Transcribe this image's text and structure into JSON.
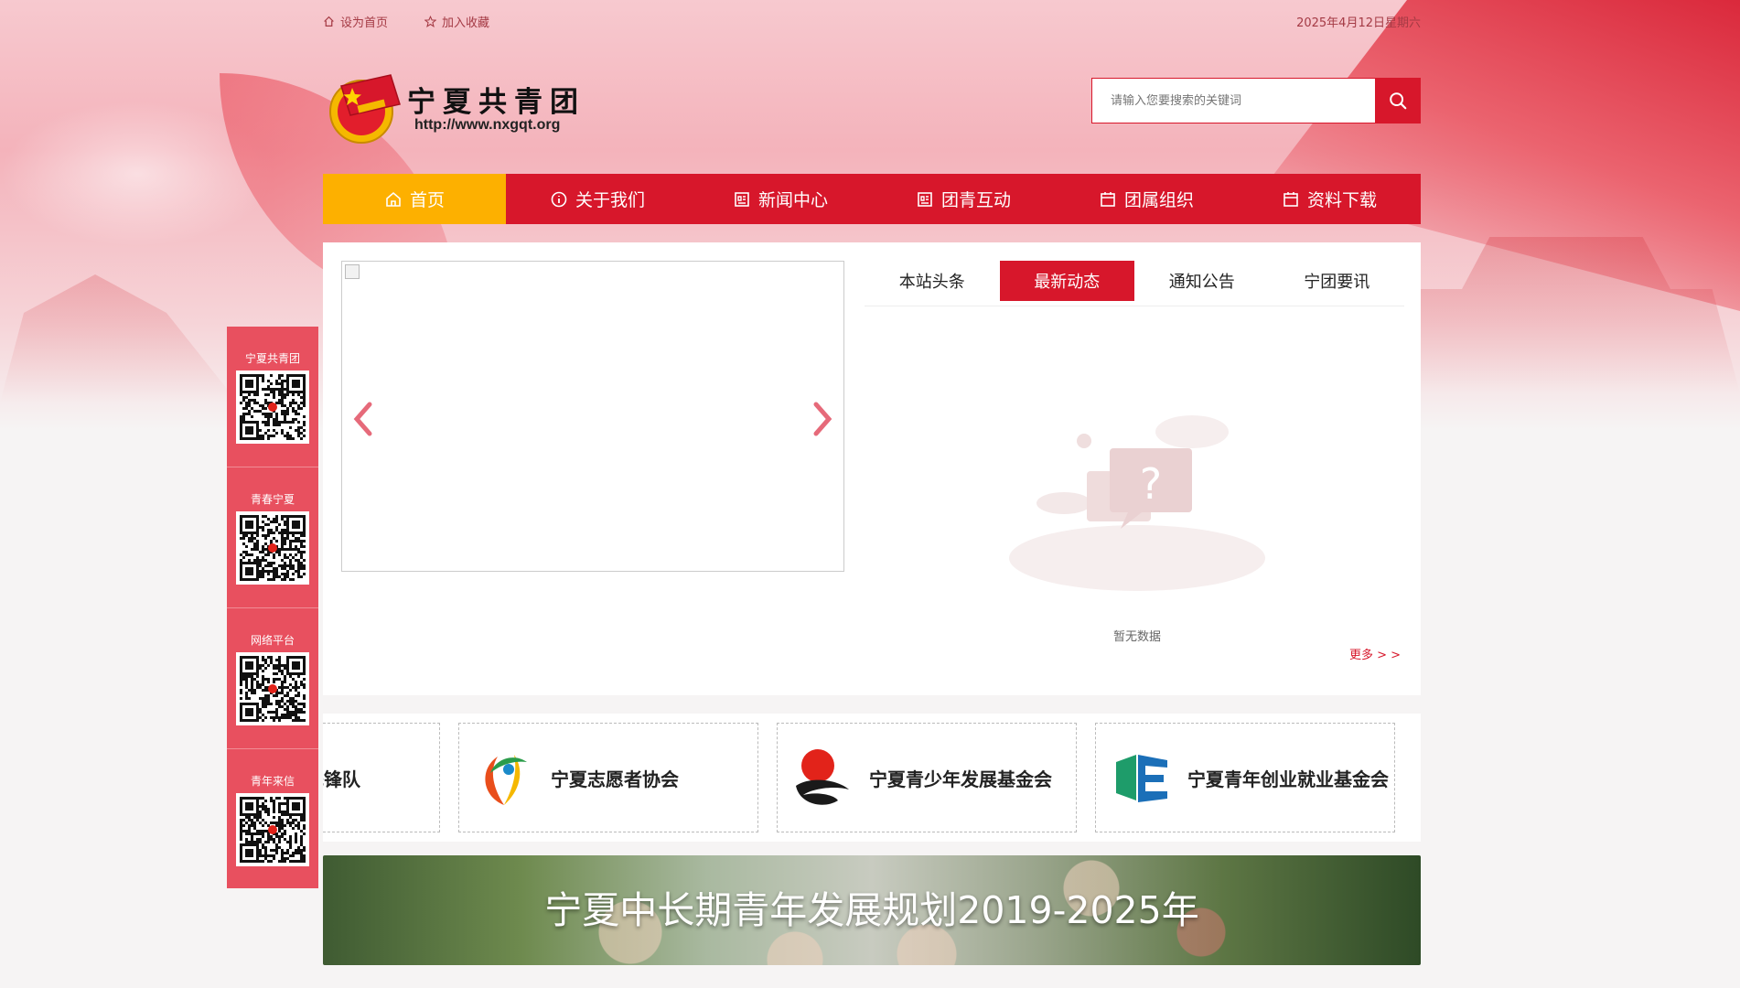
{
  "topbar": {
    "set_home": "设为首页",
    "add_favorite": "加入收藏",
    "date": "2025年4月12日星期六"
  },
  "logo": {
    "title": "宁夏共青团",
    "url": "http://www.nxgqt.org"
  },
  "search": {
    "placeholder": "请输入您要搜索的关键词"
  },
  "nav": {
    "items": [
      {
        "label": "首页",
        "icon": "home-icon"
      },
      {
        "label": "关于我们",
        "icon": "info-icon"
      },
      {
        "label": "新闻中心",
        "icon": "news-icon"
      },
      {
        "label": "团青互动",
        "icon": "news-icon"
      },
      {
        "label": "团属组织",
        "icon": "calendar-icon"
      },
      {
        "label": "资料下载",
        "icon": "calendar-icon"
      }
    ],
    "active_index": 0
  },
  "news": {
    "tabs": [
      "本站头条",
      "最新动态",
      "通知公告",
      "宁团要讯"
    ],
    "active_tab": 1,
    "empty_text": "暂无数据",
    "more_label": "更多 > >"
  },
  "partners": [
    "宁夏少年先锋队",
    "宁夏志愿者协会",
    "宁夏青少年发展基金会",
    "宁夏青年创业就业基金会"
  ],
  "banner": {
    "title": "宁夏中长期青年发展规划2019-2025年"
  },
  "qr_panel": [
    {
      "label": "宁夏共青团"
    },
    {
      "label": "青春宁夏"
    },
    {
      "label": "网络平台"
    },
    {
      "label": "青年来信"
    }
  ],
  "colors": {
    "brand_red": "#d7172b",
    "nav_active": "#fdb000",
    "qr_panel": "#e8505f"
  }
}
